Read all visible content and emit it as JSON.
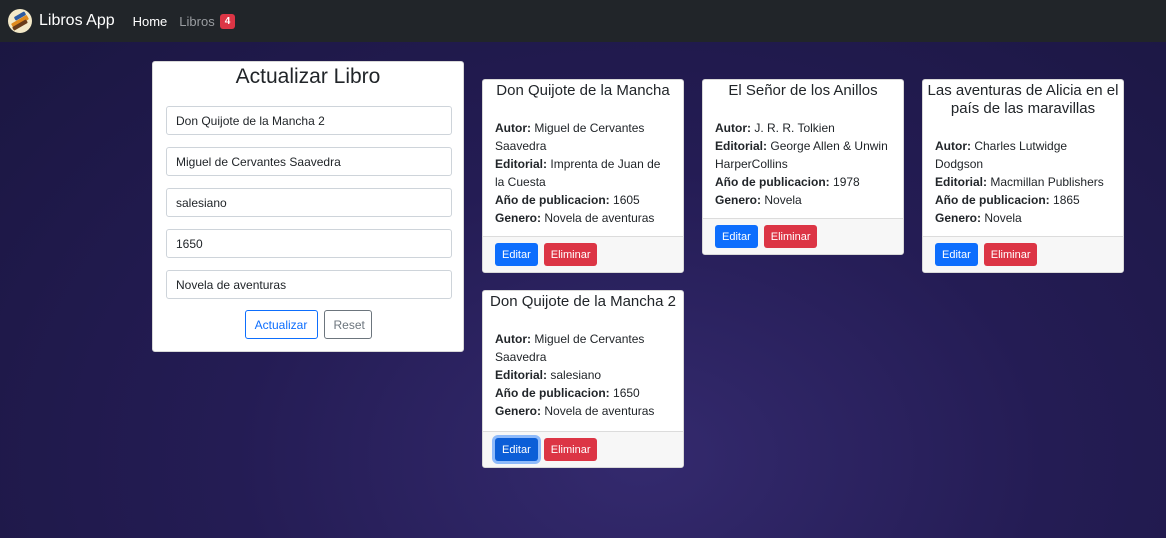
{
  "navbar": {
    "brand": "Libros App",
    "home": "Home",
    "libros": "Libros",
    "libros_count": "4"
  },
  "form": {
    "title": "Actualizar Libro",
    "fields": [
      "Don Quijote de la Mancha 2",
      "Miguel de Cervantes Saavedra",
      "salesiano",
      "1650",
      "Novela de aventuras"
    ],
    "update_label": "Actualizar",
    "reset_label": "Reset"
  },
  "labels": {
    "autor": "Autor:",
    "editorial": "Editorial:",
    "anio": "Año de publicacion:",
    "genero": "Genero:",
    "edit": "Editar",
    "delete": "Eliminar"
  },
  "books": [
    {
      "title": "Don Quijote de la Mancha",
      "autor": "Miguel de Cervantes Saavedra",
      "editorial": "Imprenta de Juan de la Cuesta",
      "anio": "1605",
      "genero": "Novela de aventuras"
    },
    {
      "title": "El Señor de los Anillos",
      "autor": "J. R. R. Tolkien",
      "editorial": "George Allen & Unwin HarperCollins",
      "anio": "1978",
      "genero": "Novela"
    },
    {
      "title": "Las aventuras de Alicia en el país de las maravillas",
      "autor": "Charles Lutwidge Dodgson",
      "editorial": "Macmillan Publishers",
      "anio": "1865",
      "genero": "Novela"
    },
    {
      "title": "Don Quijote de la Mancha 2",
      "autor": "Miguel de Cervantes Saavedra",
      "editorial": "salesiano",
      "anio": "1650",
      "genero": "Novela de aventuras"
    }
  ]
}
